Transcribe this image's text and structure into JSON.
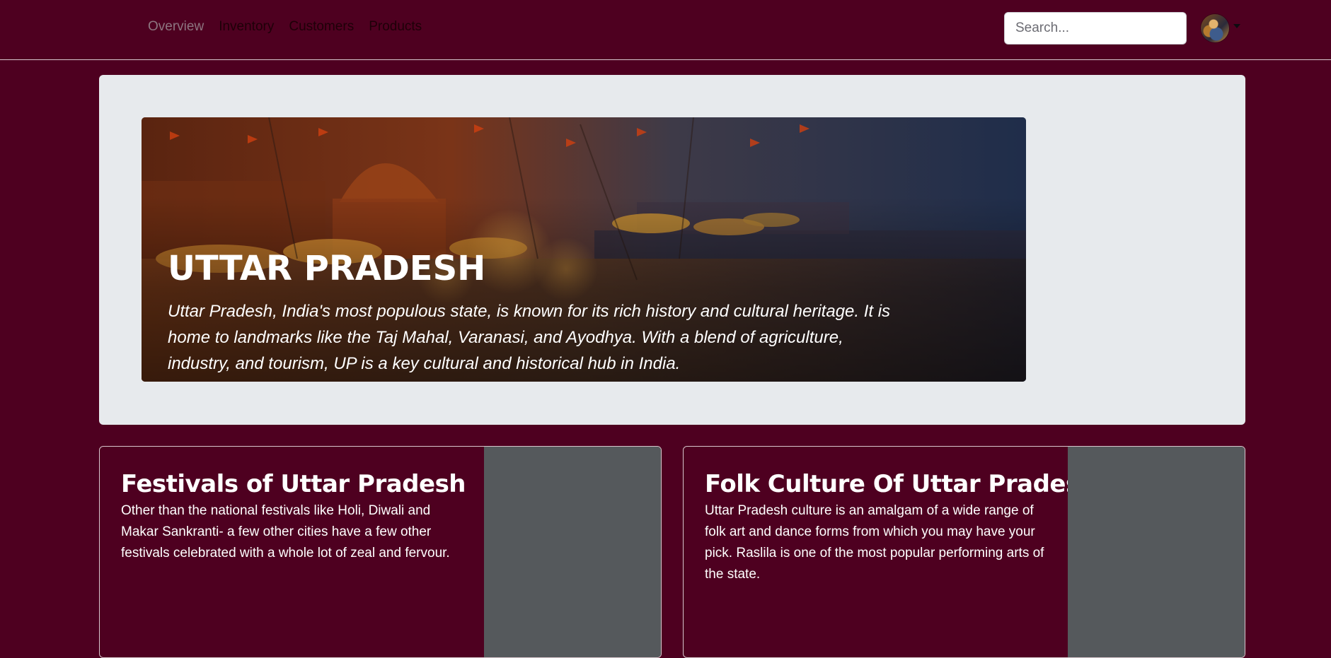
{
  "header": {
    "nav": [
      {
        "label": "Overview",
        "active": true
      },
      {
        "label": "Inventory",
        "active": false
      },
      {
        "label": "Customers",
        "active": false
      },
      {
        "label": "Products",
        "active": false
      }
    ],
    "search_placeholder": "Search...",
    "avatar_icon": "user-avatar-icon"
  },
  "hero": {
    "title": "UTTAR PRADESH",
    "description": "Uttar Pradesh, India's most populous state, is known for its rich history and cultural heritage. It is home to landmarks like the Taj Mahal, Varanasi, and Ayodhya. With a blend of agriculture, industry, and tourism, UP is a key cultural and historical hub in India."
  },
  "cards": [
    {
      "title": "Festivals of Uttar Pradesh",
      "text": "Other than the national festivals like Holi, Diwali and Makar Sankranti- a few other cities have a few other festivals celebrated with a whole lot of zeal and fervour."
    },
    {
      "title": "Folk Culture Of Uttar Pradesh",
      "text": "Uttar Pradesh culture is an amalgam of a wide range of folk art and dance forms from which you may have your pick. Raslila is one of the most popular performing arts of the state."
    }
  ],
  "colors": {
    "page_background": "#4e0020",
    "jumbotron_background": "#e7eaed",
    "card_image_placeholder": "#55595c",
    "nav_active": "#8d7580",
    "nav_inactive": "#1e0008"
  }
}
